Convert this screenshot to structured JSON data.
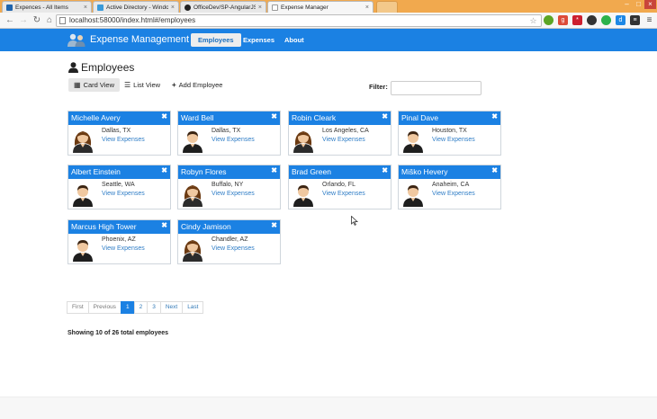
{
  "browser": {
    "tabs": [
      {
        "title": "Expences - All Items",
        "color": "#1f64ad"
      },
      {
        "title": "Active Directory - Windo",
        "color": "#3a9ad9"
      },
      {
        "title": "OfficeDev/SP-AngularJS-",
        "color": "#222222"
      },
      {
        "title": "Expense Manager",
        "color": "#dddddd"
      }
    ],
    "url": "localhost:58000/index.html#/employees",
    "extensions": [
      {
        "icon": "star-icon",
        "color": "#ffffff"
      },
      {
        "icon": "evernote-icon",
        "color": "#5ba525"
      },
      {
        "icon": "google-plus-icon",
        "color": "#dd4b39"
      },
      {
        "icon": "lastpass-icon",
        "color": "#cc1f2f"
      },
      {
        "icon": "record-icon",
        "color": "#333333"
      },
      {
        "icon": "green-dot-icon",
        "color": "#2bb24c"
      },
      {
        "icon": "dash-icon",
        "color": "#1e88e5"
      },
      {
        "icon": "layers-icon",
        "color": "#333333"
      }
    ]
  },
  "app": {
    "brand": "Expense Management",
    "nav": [
      "Employees",
      "Expenses",
      "About"
    ],
    "accent": "#1b81e3"
  },
  "page": {
    "title": "Employees",
    "views": [
      "Card View",
      "List View",
      "Add Employee"
    ],
    "filter_label": "Filter:",
    "filter_value": ""
  },
  "employees": [
    {
      "name": "Michelle Avery",
      "location": "Dallas, TX",
      "link": "View Expenses",
      "gender": "female"
    },
    {
      "name": "Ward Bell",
      "location": "Dallas, TX",
      "link": "View Expenses",
      "gender": "male"
    },
    {
      "name": "Robin Cleark",
      "location": "Los Angeles, CA",
      "link": "View Expenses",
      "gender": "female"
    },
    {
      "name": "Pinal Dave",
      "location": "Houston, TX",
      "link": "View Expenses",
      "gender": "male"
    },
    {
      "name": "Albert Einstein",
      "location": "Seattle, WA",
      "link": "View Expenses",
      "gender": "male"
    },
    {
      "name": "Robyn Flores",
      "location": "Buffalo, NY",
      "link": "View Expenses",
      "gender": "female"
    },
    {
      "name": "Brad Green",
      "location": "Orlando, FL",
      "link": "View Expenses",
      "gender": "male"
    },
    {
      "name": "Miško Hevery",
      "location": "Anaheim, CA",
      "link": "View Expenses",
      "gender": "male"
    },
    {
      "name": "Marcus High Tower",
      "location": "Phoenix, AZ",
      "link": "View Expenses",
      "gender": "male"
    },
    {
      "name": "Cindy Jamison",
      "location": "Chandler, AZ",
      "link": "View Expenses",
      "gender": "female"
    }
  ],
  "pagination": {
    "items": [
      "First",
      "Previous",
      "1",
      "2",
      "3",
      "Next",
      "Last"
    ],
    "current": "1"
  },
  "summary": "Showing 10 of 26 total employees"
}
